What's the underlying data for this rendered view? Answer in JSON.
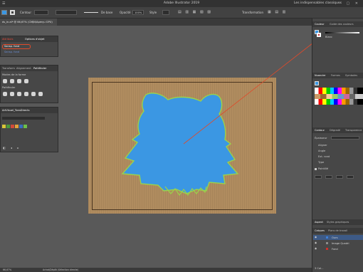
{
  "app_title": "Adobe Illustrator 2019",
  "workspace_name": "Les indispensables classiques",
  "control_bar": {
    "selection_label": "Contour",
    "stroke_style_label": "De base",
    "opacity_label": "Opacité",
    "opacity_value": "100%",
    "style_label": "Style",
    "transform_label": "Transformation"
  },
  "document_tab": "ds_in.ai* @ 66,67% (CMJN/Aperçu GPU)",
  "left_panels": {
    "top": {
      "tabs": [
        "Attributs",
        "Options d'objet"
      ],
      "row1": "Sansp. fond",
      "row2": "Sansp. fond"
    },
    "pathfinder": {
      "tabs": [
        "Transform",
        "Alignement",
        "Pathfinder"
      ],
      "mode_label": "Modes de la forme",
      "apply_label": "Pathfinder"
    },
    "brushes": {
      "tab": "ArtVisuel_TonsDirects"
    }
  },
  "right_panels": {
    "color_tabs": [
      "Couleur",
      "Guide des couleurs"
    ],
    "color_row": "Blanc",
    "swatch_tabs": [
      "Nuancier",
      "Formes",
      "Symboles"
    ],
    "stroke_tabs": [
      "Contour",
      "Dégradé",
      "Transparence"
    ],
    "stroke_fields": [
      "Épaisseur",
      "Aligner",
      "Angle",
      "Ext. rond",
      "Type"
    ],
    "dashed_label": "Pointillé",
    "aspect_tabs": [
      "Aspect",
      "Styles graphiques"
    ],
    "layer_tabs": [
      "Calques",
      "Plans de travail"
    ],
    "layers": [
      {
        "name": "Ours",
        "color": "#3f7fd6",
        "selected": true
      },
      {
        "name": "Image Quadri",
        "color": "#8c8c8c",
        "selected": false
      },
      {
        "name": "Fond",
        "color": "#d0302a",
        "selected": false
      }
    ],
    "layers_count": "3 Cal..."
  },
  "status": {
    "zoom": "66,67%",
    "tool": "Achat/Dépôt (Sélection directe)"
  },
  "colors": {
    "shape_fill": "#3b97e3",
    "shape_edge": "#9ad24a",
    "guide_line": "#e04a2a",
    "cardboard": "#b08c5f"
  }
}
